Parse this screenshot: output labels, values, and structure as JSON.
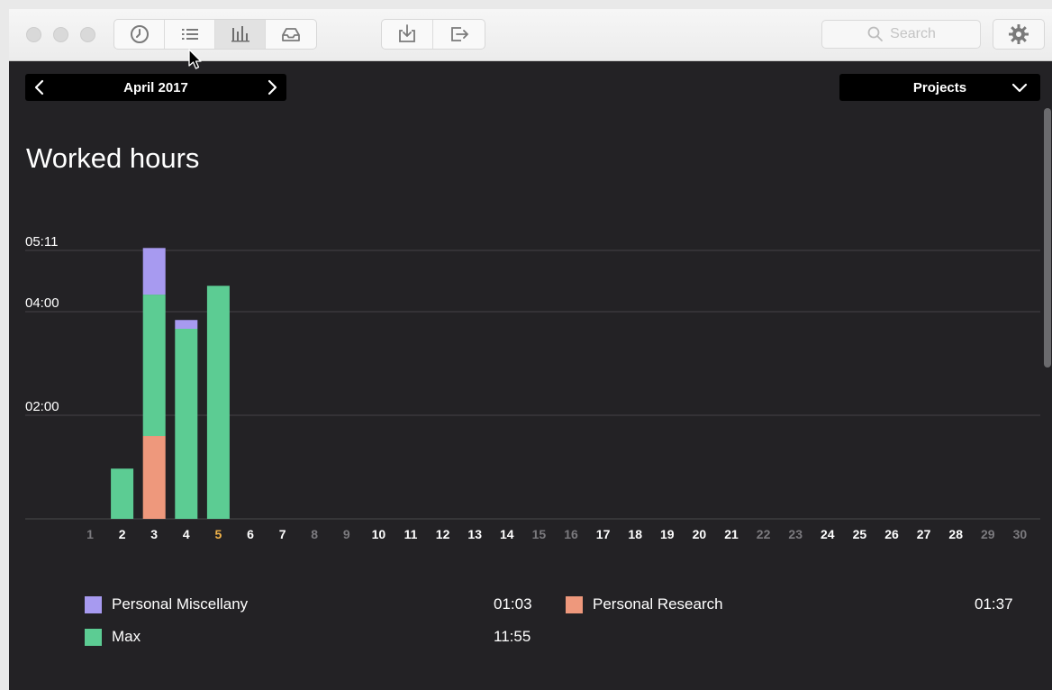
{
  "toolbar": {
    "tabs": [
      {
        "icon": "clock-icon",
        "active": false
      },
      {
        "icon": "list-icon",
        "active": false
      },
      {
        "icon": "bar-chart-icon",
        "active": true
      },
      {
        "icon": "inbox-icon",
        "active": false
      }
    ],
    "actions": [
      {
        "icon": "import-icon"
      },
      {
        "icon": "export-icon"
      }
    ],
    "search_placeholder": "Search"
  },
  "nav": {
    "month": "April 2017",
    "grouping": "Projects"
  },
  "page_title": "Worked hours",
  "colors": {
    "background": "#232225",
    "personal_miscellany": "#a79af0",
    "personal_research": "#ee987c",
    "max": "#5ccc93",
    "today_highlight": "#f0b34a"
  },
  "chart_data": {
    "type": "bar",
    "stacked": true,
    "title": "Worked hours",
    "y_ticks": [
      "02:00",
      "04:00",
      "05:11"
    ],
    "y_tick_values": [
      2,
      4,
      5.1833
    ],
    "ylim": [
      0,
      5.1833
    ],
    "categories": [
      "1",
      "2",
      "3",
      "4",
      "5",
      "6",
      "7",
      "8",
      "9",
      "10",
      "11",
      "12",
      "13",
      "14",
      "15",
      "16",
      "17",
      "18",
      "19",
      "20",
      "21",
      "22",
      "23",
      "24",
      "25",
      "26",
      "27",
      "28",
      "29",
      "30"
    ],
    "weekend_days": [
      "1",
      "8",
      "9",
      "15",
      "16",
      "22",
      "23",
      "29",
      "30"
    ],
    "highlight_day": "5",
    "grid": true,
    "series": [
      {
        "name": "Personal Research",
        "color": "#ee987c",
        "values": [
          0,
          0,
          1.6,
          0,
          0,
          0,
          0,
          0,
          0,
          0,
          0,
          0,
          0,
          0,
          0,
          0,
          0,
          0,
          0,
          0,
          0,
          0,
          0,
          0,
          0,
          0,
          0,
          0,
          0,
          0
        ]
      },
      {
        "name": "Max",
        "color": "#5ccc93",
        "values": [
          0,
          0.97,
          2.73,
          3.67,
          4.5,
          0,
          0,
          0,
          0,
          0,
          0,
          0,
          0,
          0,
          0,
          0,
          0,
          0,
          0,
          0,
          0,
          0,
          0,
          0,
          0,
          0,
          0,
          0,
          0,
          0
        ]
      },
      {
        "name": "Personal Miscellany",
        "color": "#a79af0",
        "values": [
          0,
          0,
          0.9,
          0.17,
          0,
          0,
          0,
          0,
          0,
          0,
          0,
          0,
          0,
          0,
          0,
          0,
          0,
          0,
          0,
          0,
          0,
          0,
          0,
          0,
          0,
          0,
          0,
          0,
          0,
          0
        ]
      }
    ]
  },
  "legend": [
    {
      "name": "Personal Miscellany",
      "total": "01:03",
      "color": "#a79af0"
    },
    {
      "name": "Personal Research",
      "total": "01:37",
      "color": "#ee987c"
    },
    {
      "name": "Max",
      "total": "11:55",
      "color": "#5ccc93"
    }
  ]
}
